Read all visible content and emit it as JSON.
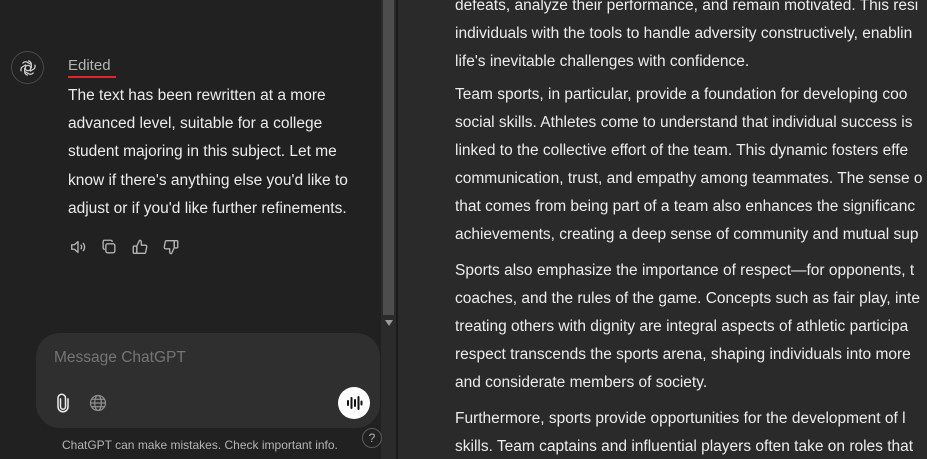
{
  "chat": {
    "edited_label": "Edited",
    "assistant_lines": [
      "The text has been rewritten at a more",
      "advanced level, suitable for a college",
      "student majoring in this subject. Let me",
      "know if there's anything else you'd like to",
      "adjust or if you'd like further refinements."
    ],
    "actions": [
      {
        "icon": "read-aloud-icon"
      },
      {
        "icon": "copy-icon"
      },
      {
        "icon": "thumbs-up-icon"
      },
      {
        "icon": "thumbs-down-icon"
      }
    ]
  },
  "composer": {
    "placeholder": "Message ChatGPT",
    "attach_icon": "paperclip-icon",
    "globe_icon": "globe-icon",
    "voice_icon": "voice-waveform-icon"
  },
  "footer": {
    "disclaimer": "ChatGPT can make mistakes. Check important info.",
    "help": "?"
  },
  "document": {
    "paragraphs": [
      [
        "defeats, analyze their performance, and remain motivated. This resi",
        "individuals with the tools to handle adversity constructively, enablin",
        "life's inevitable challenges with confidence."
      ],
      [
        "Team sports, in particular, provide a foundation for developing coo",
        "social skills. Athletes come to understand that individual success is",
        "linked to the collective effort of the team. This dynamic fosters effe",
        "communication, trust, and empathy among teammates. The sense o",
        "that comes from being part of a team also enhances the significanc",
        "achievements, creating a deep sense of community and mutual sup"
      ],
      [
        "Sports also emphasize the importance of respect—for opponents, t",
        "coaches, and the rules of the game. Concepts such as fair play, inte",
        "treating others with dignity are integral aspects of athletic participa",
        "respect transcends the sports arena, shaping individuals into more",
        "and considerate members of society."
      ],
      [
        "Furthermore, sports provide opportunities for the development of l",
        "skills. Team captains and influential players often take on roles that"
      ]
    ]
  },
  "colors": {
    "background": "#212121",
    "document_background": "#2a2a2a",
    "edited_underline": "#e0242b",
    "composer_background": "#2f2f2f"
  }
}
